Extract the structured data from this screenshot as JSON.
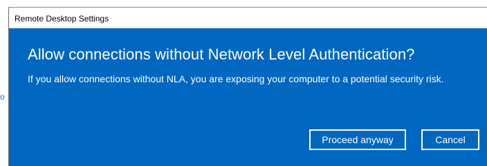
{
  "background": {
    "link_glyph": "o"
  },
  "window": {
    "title": "Remote Desktop Settings"
  },
  "dialog": {
    "heading": "Allow connections without Network Level Authentication?",
    "message": "If you allow connections without NLA, you are exposing your computer to a potential security risk.",
    "buttons": {
      "proceed_label": "Proceed anyway",
      "cancel_label": "Cancel"
    }
  },
  "colors": {
    "dialog_background": "#0067c0",
    "button_border": "#ffffff",
    "text_on_accent": "#ffffff"
  }
}
